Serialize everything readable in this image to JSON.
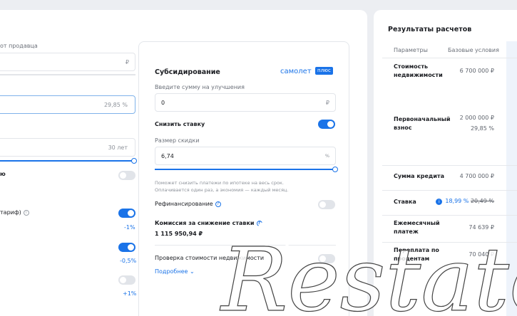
{
  "left_form": {
    "seller_label_fragment": "от продавца",
    "price_unit": "₽",
    "down_payment_value": "29,85 %",
    "term_value": "30 лет",
    "toggle1_label_fragment": "ю",
    "tariff_label_fragment": "тариф)",
    "delta1": "-1%",
    "delta2": "-0,5%",
    "delta3": "+1%"
  },
  "subsidy": {
    "title": "Субсидирование",
    "brand": "самолет",
    "brand_badge": "плюс",
    "improvement_label": "Введите сумму на улучшения",
    "improvement_value": "0",
    "improvement_unit": "₽",
    "reduce_rate_label": "Снизить ставку",
    "discount_label": "Размер скидки",
    "discount_value": "6,74",
    "discount_unit": "%",
    "hint_line1": "Поможет снизить платежи по ипотеке на весь срок.",
    "hint_line2": "Оплачивается один раз, а экономия — каждый месяц.",
    "refinance_label": "Рефинансирование",
    "commission_label": "Комиссия за снижение ставки",
    "commission_value": "1 115 950,94 ₽",
    "check_label": "Проверка стоимости недвижимости",
    "more_link": "Подробнее"
  },
  "results": {
    "title": "Результаты расчетов",
    "col_params": "Параметры",
    "col_base": "Базовые условия",
    "rows": {
      "price_label": "Стоимость недвижимости",
      "price_value": "6 700 000 ₽",
      "down_label": "Первоначальный взнос",
      "down_value": "2 000 000 ₽",
      "down_percent": "29,85 %",
      "credit_label": "Сумма кредита",
      "credit_value": "4 700 000 ₽",
      "rate_label": "Ставка",
      "rate_value": "18,99 %",
      "rate_old": "20,49 %",
      "monthly_label": "Ежемесячный платеж",
      "monthly_value": "74 639 ₽",
      "overpay_label": "Переплата по процентам",
      "overpay_value": "70 040 ₽"
    }
  },
  "watermark": {
    "text": "Restate"
  },
  "colors": {
    "accent": "#1a73e8",
    "background": "#eceef2",
    "card": "#ffffff"
  }
}
